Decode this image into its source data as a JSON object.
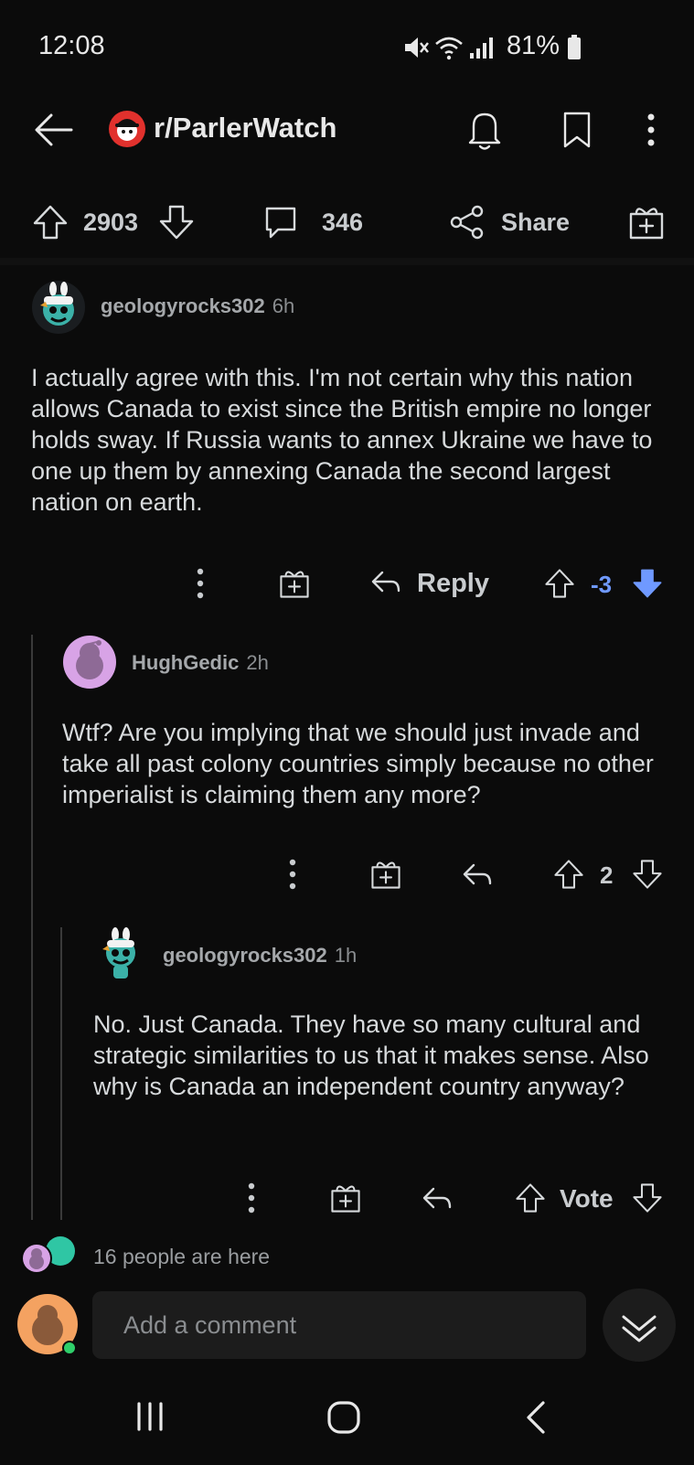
{
  "status_bar": {
    "time": "12:08",
    "battery": "81%"
  },
  "header": {
    "subreddit": "r/ParlerWatch"
  },
  "post_actions": {
    "score": "2903",
    "comments": "346",
    "share_label": "Share"
  },
  "comments": [
    {
      "author": "geologyrocks302",
      "age": "6h",
      "body": "I actually agree with this. I'm not certain why this nation allows Canada to exist since the British empire no longer holds sway. If Russia wants to annex Ukraine we have to one up them by annexing Canada the second largest nation on earth.",
      "reply_label": "Reply",
      "score": "-3",
      "downvoted": true
    },
    {
      "author": "HughGedic",
      "age": "2h",
      "body": "Wtf? Are you implying that we should just invade and take all past colony countries simply because no other imperialist is claiming them any more?",
      "score": "2"
    },
    {
      "author": "geologyrocks302",
      "age": "1h",
      "body": "No. Just Canada. They have so many cultural and strategic similarities to us that it makes sense. Also why is Canada an independent country anyway?",
      "score": "Vote"
    }
  ],
  "presence": {
    "text": "16 people are here"
  },
  "composer": {
    "placeholder": "Add a comment"
  },
  "colors": {
    "downvote_blue": "#6f99ff",
    "accent_red": "#e1312d",
    "background": "#0b0b0b"
  }
}
